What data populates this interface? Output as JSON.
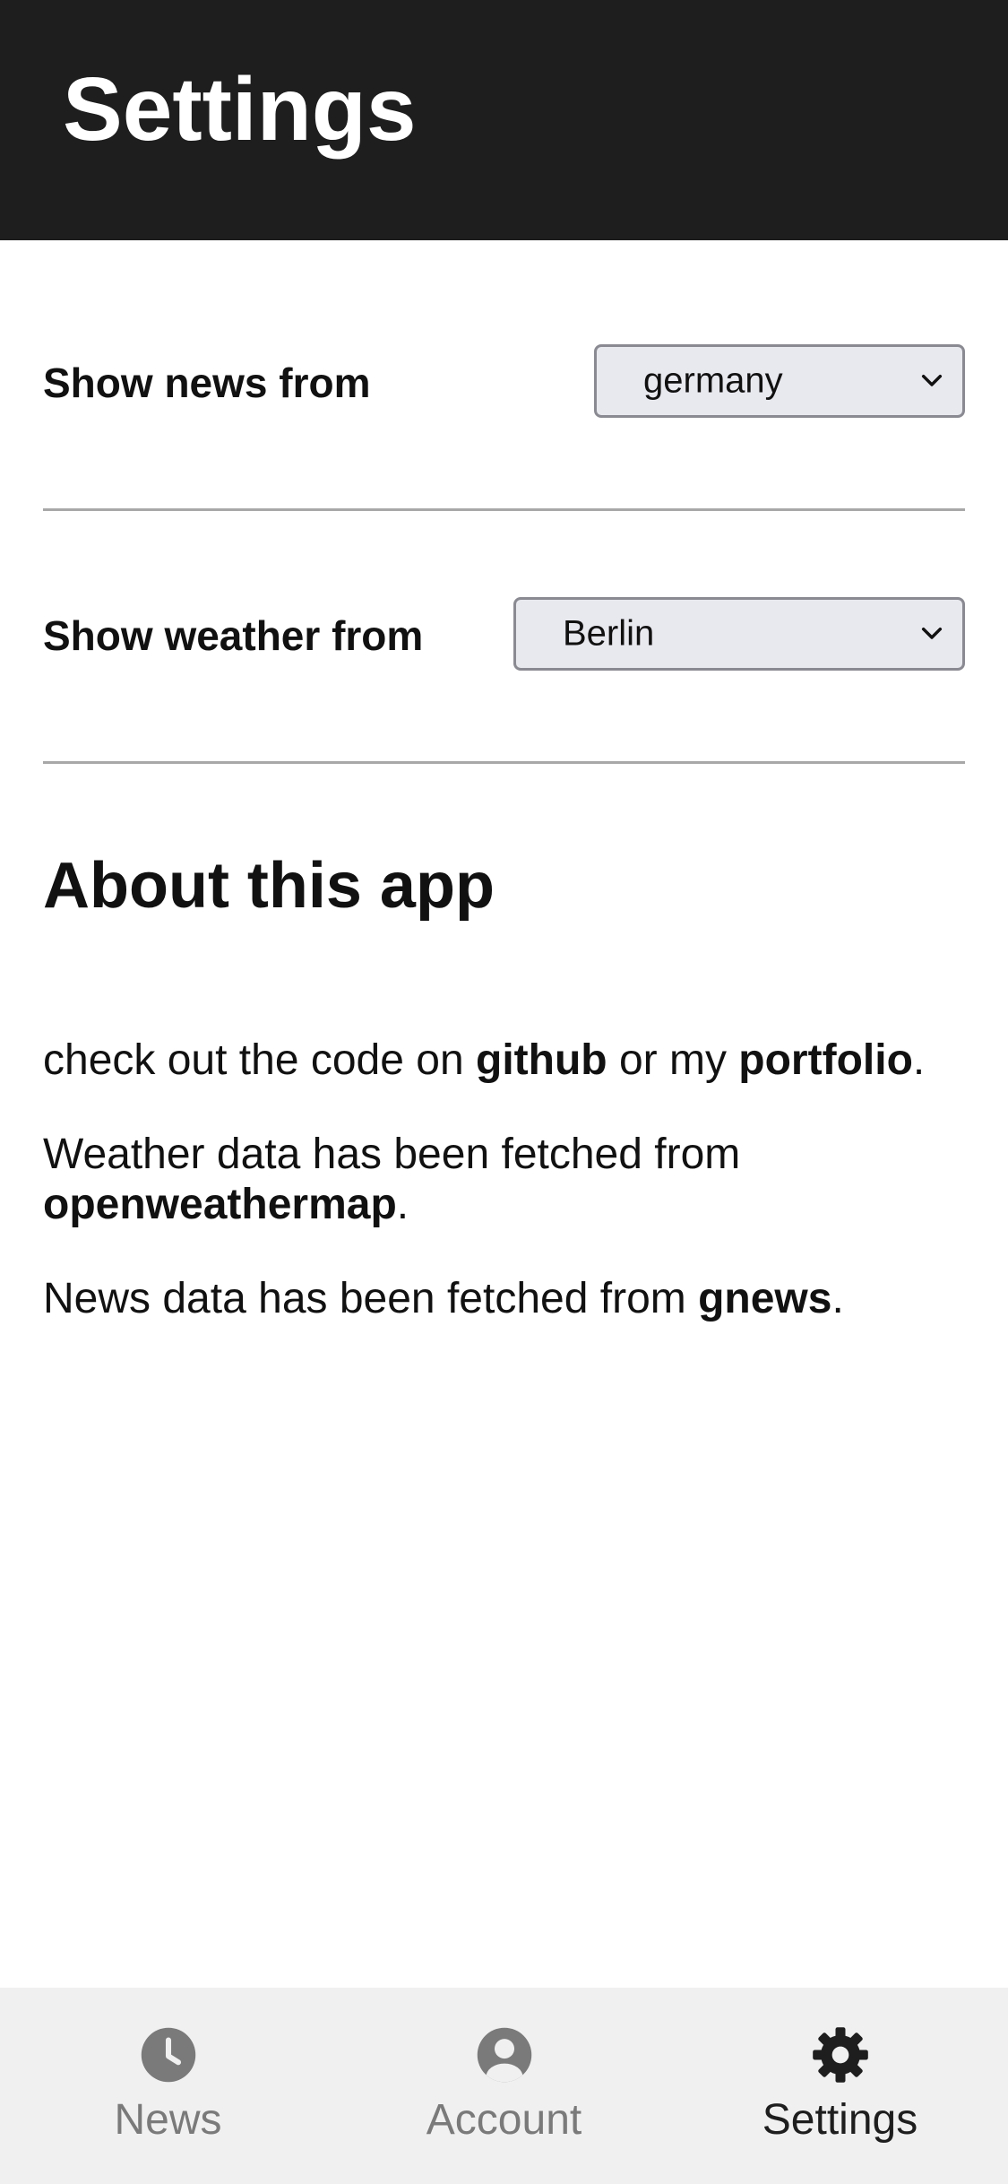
{
  "header": {
    "title": "Settings"
  },
  "settings": {
    "news": {
      "label": "Show news from",
      "value": "germany"
    },
    "weather": {
      "label": "Show weather from",
      "value": "Berlin"
    }
  },
  "about": {
    "title": "About this app",
    "p1": {
      "prefix": "check out the code on ",
      "link1": "github",
      "middle": " or my ",
      "link2": "portfolio",
      "suffix": "."
    },
    "p2": {
      "prefix": "Weather data has been fetched from ",
      "link": "openweathermap",
      "suffix": "."
    },
    "p3": {
      "prefix": "News data has been fetched from ",
      "link": "gnews",
      "suffix": "."
    }
  },
  "tabbar": {
    "tabs": [
      {
        "label": "News",
        "icon": "clock-icon",
        "active": false
      },
      {
        "label": "Account",
        "icon": "account-icon",
        "active": false
      },
      {
        "label": "Settings",
        "icon": "gear-icon",
        "active": true
      }
    ]
  },
  "colors": {
    "header_bg": "#1e1e1e",
    "tabbar_bg": "#f0f0f0",
    "inactive": "#7a7a7a",
    "active": "#1e1e1e"
  }
}
